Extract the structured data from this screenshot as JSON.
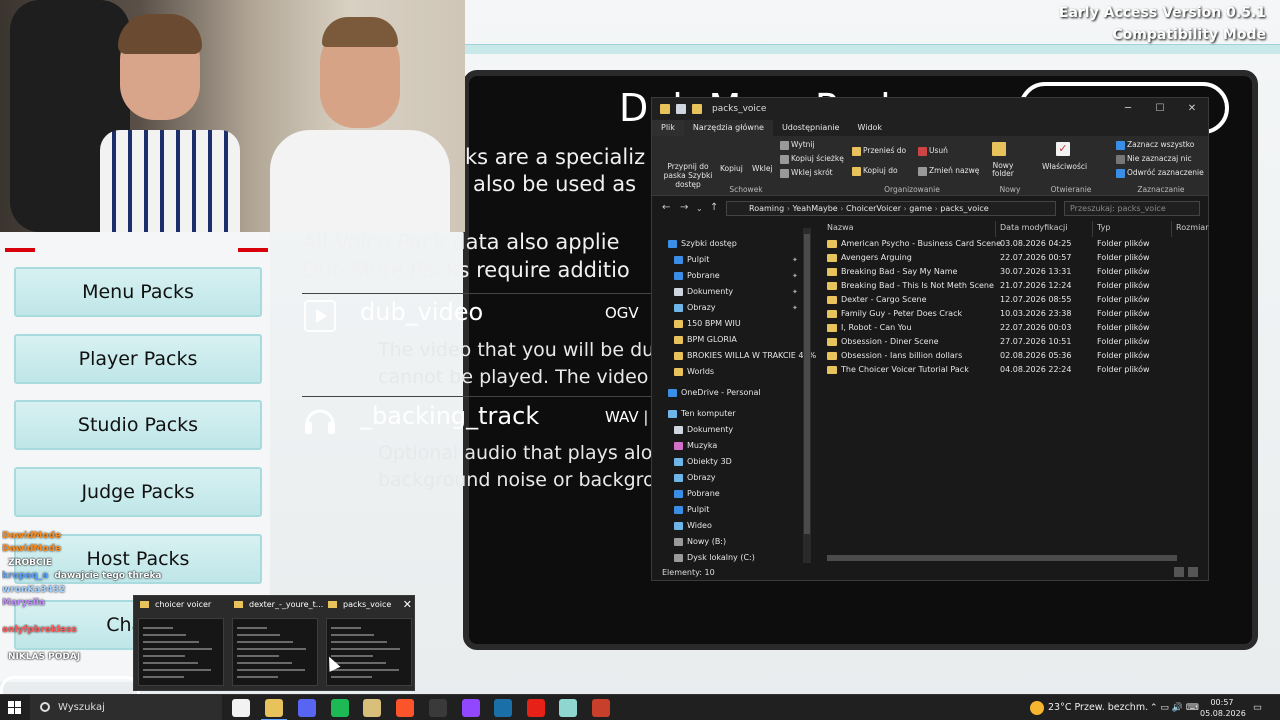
{
  "game": {
    "version_line1": "Early Access Version 0.5.1",
    "version_line2": "Compatibility Mode",
    "title": "Dub More Packs",
    "intro": [
      "ks are a specializ",
      "also be used as"
    ],
    "info": [
      "All Voice Pack data also applie",
      "Dub More Packs require additio"
    ],
    "files": [
      {
        "name": "dub_video",
        "format": "OGV",
        "icon": "play-icon",
        "desc": [
          "The video that you will be du",
          "cannot be played. The video v"
        ]
      },
      {
        "name": "_backing_track",
        "format": "WAV | I",
        "icon": "headphones-icon",
        "desc": [
          "Optional audio that plays alon",
          "background noise or backgrou"
        ]
      }
    ],
    "menu": [
      "Menu Packs",
      "Player Packs",
      "Studio Packs",
      "Judge Packs",
      "Host Packs",
      "Chatte"
    ]
  },
  "chat": [
    {
      "user": "",
      "msg": "",
      "color": "#ff4d4d"
    },
    {
      "user": "DawidMode",
      "msg": "",
      "color": "#ff8c1a"
    },
    {
      "user": "DawidMode",
      "msg": "",
      "color": "#ff8c1a"
    },
    {
      "user": "",
      "msg": "ZROBCIE",
      "color": "#ffd24d"
    },
    {
      "user": "krupaq_a",
      "msg": "dawajcie tego threka",
      "color": "#5aa0ff"
    },
    {
      "user": "wronKa3432",
      "msg": "",
      "color": "#9fd0ff"
    },
    {
      "user": "Marysila",
      "msg": "",
      "color": "#c38cff"
    },
    {
      "user": "",
      "msg": "",
      "color": "#9cff6b"
    },
    {
      "user": "onlyfpbrokless",
      "msg": "",
      "color": "#ff5a5a"
    },
    {
      "user": "",
      "msg": "",
      "color": "#9cff6b"
    },
    {
      "user": "",
      "msg": "NIKLAS PODAJ",
      "color": "#9cff6b"
    }
  ],
  "explorer": {
    "title": "packs_voice",
    "tabs": [
      "Plik",
      "Narzędzia główne",
      "Udostępnianie",
      "Widok"
    ],
    "ribbon": {
      "clipboard": {
        "pin": "Przypnij do paska Szybki dostęp",
        "copy": "Kopiuj",
        "paste": "Wklej",
        "cut": "Wytnij",
        "copy_path": "Kopiuj ścieżkę",
        "paste_shortcut": "Wklej skrót",
        "label": "Schowek"
      },
      "organize": {
        "move": "Przenieś do",
        "copy_to": "Kopiuj do",
        "delete": "Usuń",
        "rename": "Zmień nazwę",
        "label": "Organizowanie"
      },
      "new": {
        "folder": "Nowy folder",
        "label": "Nowy"
      },
      "open": {
        "properties": "Właściwości",
        "label": "Otwieranie"
      },
      "select": {
        "all": "Zaznacz wszystko",
        "none": "Nie zaznaczaj nic",
        "invert": "Odwróć zaznaczenie",
        "label": "Zaznaczanie"
      }
    },
    "breadcrumb": [
      "Roaming",
      "YeahMaybe",
      "ChoicerVoicer",
      "game",
      "packs_voice"
    ],
    "search_placeholder": "Przeszukaj: packs_voice",
    "nav": [
      {
        "label": "Szybki dostęp",
        "color": "#3b8ee8",
        "indent": 0,
        "pin": false
      },
      {
        "label": "Pulpit",
        "color": "#3b8ee8",
        "indent": 1,
        "pin": true
      },
      {
        "label": "Pobrane",
        "color": "#3b8ee8",
        "indent": 1,
        "pin": true
      },
      {
        "label": "Dokumenty",
        "color": "#cfd6e0",
        "indent": 1,
        "pin": true
      },
      {
        "label": "Obrazy",
        "color": "#6fb6e8",
        "indent": 1,
        "pin": true
      },
      {
        "label": "150 BPM WIU",
        "color": "#e8c25a",
        "indent": 1,
        "pin": false
      },
      {
        "label": "BPM GLORIA",
        "color": "#e8c25a",
        "indent": 1,
        "pin": false
      },
      {
        "label": "BROKIES WILLA W TRAKCIE 45%",
        "color": "#e8c25a",
        "indent": 1,
        "pin": false
      },
      {
        "label": "Worlds",
        "color": "#e8c25a",
        "indent": 1,
        "pin": false
      },
      {
        "label": "OneDrive - Personal",
        "color": "#3b8ee8",
        "indent": 0,
        "pin": false
      },
      {
        "label": "Ten komputer",
        "color": "#6fb6e8",
        "indent": 0,
        "pin": false
      },
      {
        "label": "Dokumenty",
        "color": "#cfd6e0",
        "indent": 1,
        "pin": false
      },
      {
        "label": "Muzyka",
        "color": "#d46fc8",
        "indent": 1,
        "pin": false
      },
      {
        "label": "Obiekty 3D",
        "color": "#6fb6e8",
        "indent": 1,
        "pin": false
      },
      {
        "label": "Obrazy",
        "color": "#6fb6e8",
        "indent": 1,
        "pin": false
      },
      {
        "label": "Pobrane",
        "color": "#3b8ee8",
        "indent": 1,
        "pin": false
      },
      {
        "label": "Pulpit",
        "color": "#3b8ee8",
        "indent": 1,
        "pin": false
      },
      {
        "label": "Wideo",
        "color": "#6fb6e8",
        "indent": 1,
        "pin": false
      },
      {
        "label": "Nowy (B:)",
        "color": "#9a9a9a",
        "indent": 1,
        "pin": false
      },
      {
        "label": "Dysk lokalny (C:)",
        "color": "#9a9a9a",
        "indent": 1,
        "pin": false
      }
    ],
    "columns": [
      "Nazwa",
      "Data modyfikacji",
      "Typ",
      "Rozmiar"
    ],
    "files": [
      {
        "name": "American Psycho - Business Card Scene",
        "date": "03.08.2026 04:25",
        "type": "Folder plików"
      },
      {
        "name": "Avengers Arguing",
        "date": "22.07.2026 00:57",
        "type": "Folder plików"
      },
      {
        "name": "Breaking Bad - Say My Name",
        "date": "30.07.2026 13:31",
        "type": "Folder plików"
      },
      {
        "name": "Breaking Bad - This Is Not Meth Scene",
        "date": "21.07.2026 12:24",
        "type": "Folder plików"
      },
      {
        "name": "Dexter - Cargo Scene",
        "date": "12.07.2026 08:55",
        "type": "Folder plików"
      },
      {
        "name": "Family Guy - Peter Does Crack",
        "date": "10.03.2026 23:38",
        "type": "Folder plików"
      },
      {
        "name": "I, Robot - Can You",
        "date": "22.07.2026 00:03",
        "type": "Folder plików"
      },
      {
        "name": "Obsession - Diner Scene",
        "date": "27.07.2026 10:51",
        "type": "Folder plików"
      },
      {
        "name": "Obsession - Ians billion dollars",
        "date": "02.08.2026 05:36",
        "type": "Folder plików"
      },
      {
        "name": "The Choicer Voicer Tutorial Pack",
        "date": "04.08.2026 22:24",
        "type": "Folder plików"
      }
    ],
    "status": "Elementy: 10"
  },
  "thumbnails": [
    {
      "title": "choicer voicer"
    },
    {
      "title": "dexter_-_youre_t..."
    },
    {
      "title": "packs_voice"
    }
  ],
  "taskbar": {
    "search": "Wyszukaj",
    "apps": [
      {
        "name": "file-icon",
        "color": "#f2f2f2",
        "active": false
      },
      {
        "name": "explorer-icon",
        "color": "#e8c25a",
        "active": true
      },
      {
        "name": "discord-icon",
        "color": "#5865f2",
        "active": false
      },
      {
        "name": "spotify-icon",
        "color": "#1db954",
        "active": false
      },
      {
        "name": "app-icon",
        "color": "#d8c07a",
        "active": false
      },
      {
        "name": "brave-icon",
        "color": "#fb542b",
        "active": false
      },
      {
        "name": "obs-icon",
        "color": "#3a3a3a",
        "active": false
      },
      {
        "name": "app2-icon",
        "color": "#9146ff",
        "active": false
      },
      {
        "name": "steam-icon",
        "color": "#1b6fa8",
        "active": false
      },
      {
        "name": "youtube-icon",
        "color": "#e62117",
        "active": false
      },
      {
        "name": "app3-icon",
        "color": "#8fd6d0",
        "active": false
      },
      {
        "name": "app4-icon",
        "color": "#c8402c",
        "active": false
      }
    ],
    "weather": "23°C  Przew. bezchm.",
    "time": "00:57",
    "date": "05.08.2026"
  }
}
